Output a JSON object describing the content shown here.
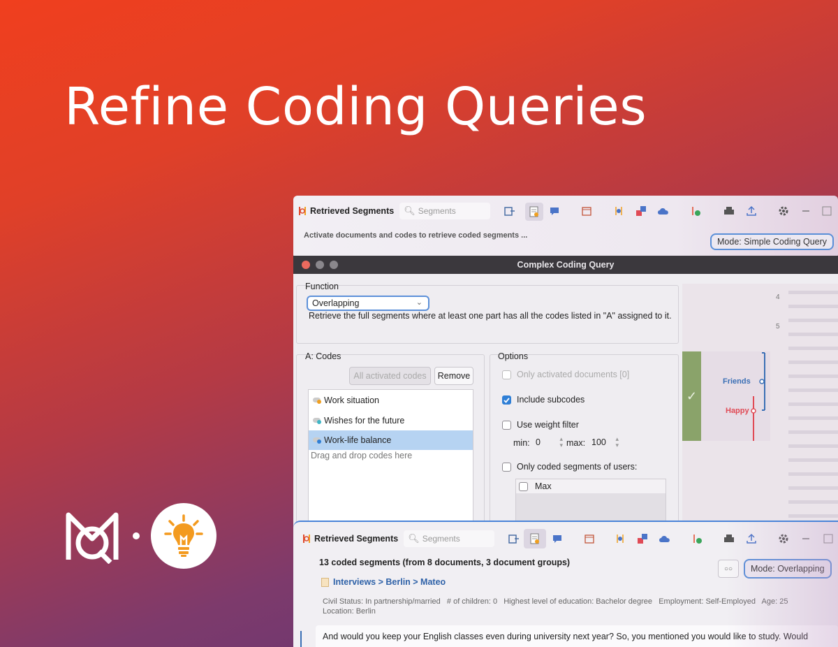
{
  "headline": "Refine Coding Queries",
  "top_window": {
    "title": "Retrieved Segments",
    "search_placeholder": "Segments",
    "status": "Activate documents and codes to retrieve coded segments ...",
    "mode": "Mode: Simple Coding Query"
  },
  "dialog": {
    "title": "Complex Coding Query",
    "function_label": "Function",
    "function_value": "Overlapping",
    "function_description": "Retrieve the full segments where at least one part has all the codes listed in \"A\" assigned to it.",
    "codes_label": "A: Codes",
    "all_activated_label": "All activated codes",
    "remove_label": "Remove",
    "codes": [
      {
        "label": "Work situation",
        "color": "#f0a020"
      },
      {
        "label": "Wishes for the future",
        "color": "#3fb6c6"
      },
      {
        "label": "Work-life balance",
        "color": "#2f7fd6"
      }
    ],
    "drop_hint": "Drag and drop codes here",
    "options_label": "Options",
    "only_activated_docs": "Only activated documents [0]",
    "include_subcodes": "Include subcodes",
    "use_weight_filter": "Use weight filter",
    "min_label": "min:",
    "min_value": "0",
    "max_label": "max:",
    "max_value": "100",
    "only_users": "Only coded segments of users:",
    "user": "Max"
  },
  "side_panel": {
    "line_numbers": [
      "4",
      "5"
    ],
    "friends_label": "Friends",
    "happy_label": "Happy",
    "colors": {
      "friends": "#3a6fb5",
      "happy": "#e04a55",
      "check_bg": "#8aa36a"
    }
  },
  "bottom_window": {
    "title": "Retrieved Segments",
    "search_placeholder": "Segments",
    "summary": "13 coded segments (from 8 documents, 3 document groups)",
    "doc_path": "Interviews > Berlin > Mateo",
    "meta_line1": "Civil Status: In partnership/married   # of children: 0   Highest level of education: Bachelor degree   Employment: Self-Employed   Age: 25",
    "meta_line2": "Location: Berlin",
    "mode": "Mode: Overlapping",
    "segment_text": "And would you keep your English classes even during university next year? So, you mentioned you would like to study. Would"
  }
}
